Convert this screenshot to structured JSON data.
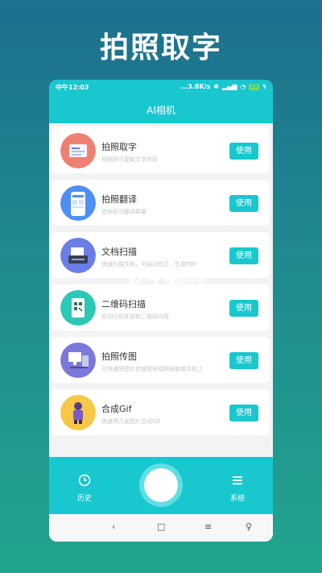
{
  "promo": {
    "title": "拍照取字"
  },
  "status_bar": {
    "time": "中午12:03",
    "network": "...3.8K/s",
    "battery": "74"
  },
  "app": {
    "title": "AI相机"
  },
  "features": [
    {
      "title": "拍照取字",
      "desc": "拍照即可提取文字内容",
      "button": "使用",
      "icon": "document-scan-icon",
      "color": "#ef8173"
    },
    {
      "title": "拍照翻译",
      "desc": "拍照即可翻译屏幕",
      "button": "使用",
      "icon": "translate-phone-icon",
      "color": "#4f8ff5"
    },
    {
      "title": "文档扫描",
      "desc": "快速扫描文档，可自动校正，生成PDF",
      "button": "使用",
      "icon": "scanner-icon",
      "color": "#6a7de8"
    },
    {
      "title": "二维码扫描",
      "desc": "自动识别并提取二维码内容",
      "button": "使用",
      "icon": "qr-code-icon",
      "color": "#2bc8b6"
    },
    {
      "title": "拍照传图",
      "desc": "可快速将图片传输到局域网电脑或手机上",
      "button": "使用",
      "icon": "transfer-icon",
      "color": "#7a78d8"
    },
    {
      "title": "合成Gif",
      "desc": "快速将几张图片合成Gif",
      "button": "使用",
      "icon": "gif-figure-icon",
      "color": "#f7c847"
    }
  ],
  "bottom_nav": {
    "history": "历史",
    "system": "系统"
  },
  "watermark": {
    "brand": "K73",
    "sub": "游戏之家",
    "url": ".com"
  }
}
